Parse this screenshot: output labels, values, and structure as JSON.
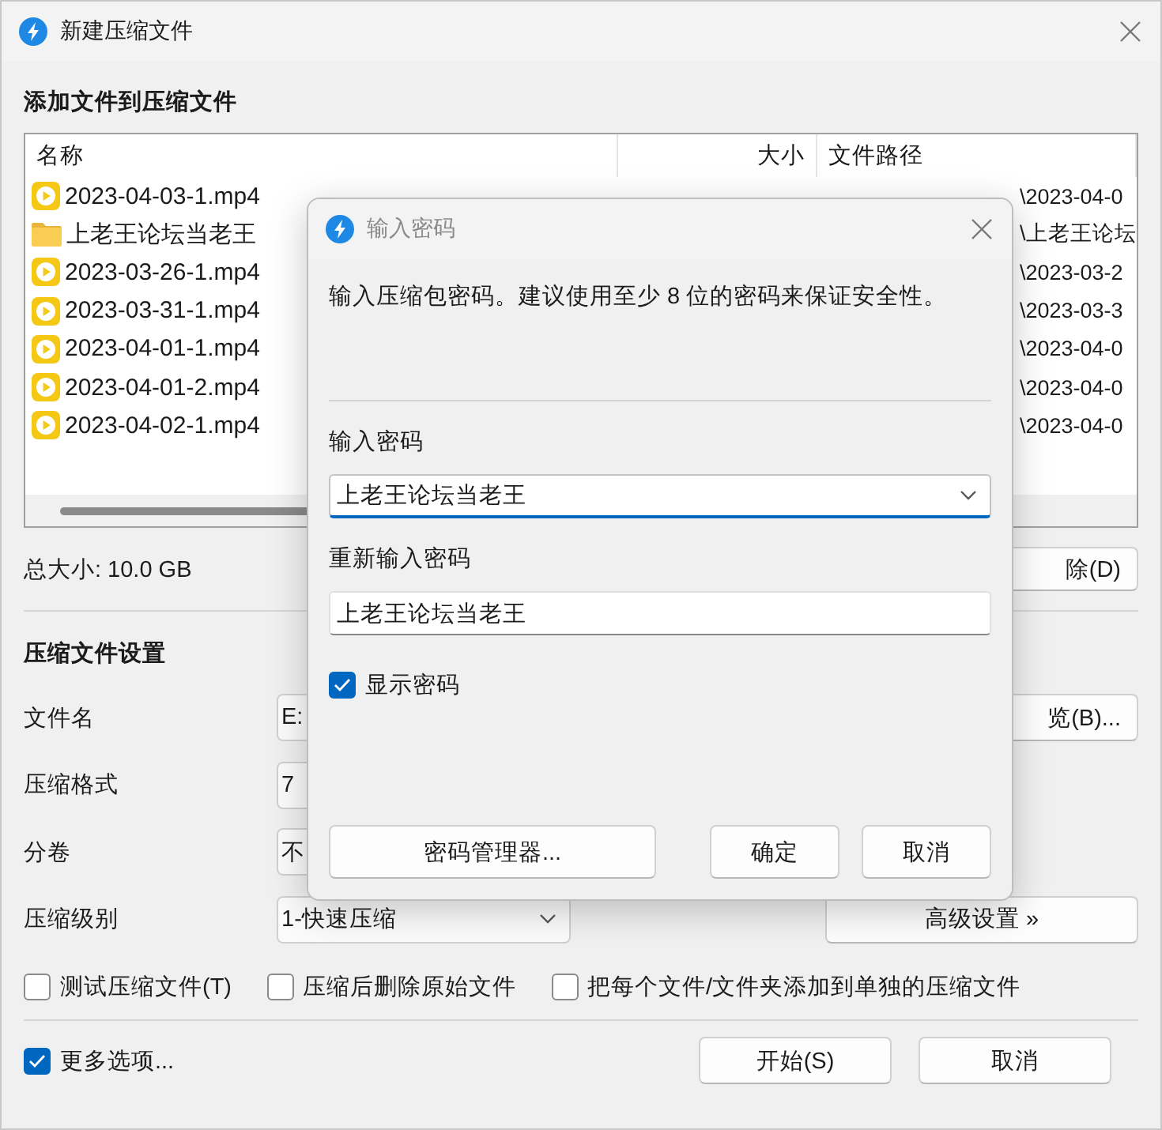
{
  "window": {
    "title": "新建压缩文件"
  },
  "files_section": {
    "heading": "添加文件到压缩文件",
    "columns": [
      "名称",
      "大小",
      "文件路径"
    ],
    "rows": [
      {
        "kind": "video",
        "name": "2023-04-03-1.mp4",
        "path": "\\2023-04-0"
      },
      {
        "kind": "folder",
        "name": "上老王论坛当老王",
        "path": "\\上老王论坛"
      },
      {
        "kind": "video",
        "name": "2023-03-26-1.mp4",
        "path": "\\2023-03-2"
      },
      {
        "kind": "video",
        "name": "2023-03-31-1.mp4",
        "path": "\\2023-03-3"
      },
      {
        "kind": "video",
        "name": "2023-04-01-1.mp4",
        "path": "\\2023-04-0"
      },
      {
        "kind": "video",
        "name": "2023-04-01-2.mp4",
        "path": "\\2023-04-0"
      },
      {
        "kind": "video",
        "name": "2023-04-02-1.mp4",
        "path": "\\2023-04-0"
      }
    ],
    "total_size": "总大小: 10.0 GB",
    "delete_button": "除(D)"
  },
  "settings": {
    "heading": "压缩文件设置",
    "fields": [
      {
        "label": "文件名",
        "kind": "text",
        "value": "E:",
        "button": "览(B)..."
      },
      {
        "label": "压缩格式",
        "kind": "select",
        "value": "7"
      },
      {
        "label": "分卷",
        "kind": "select",
        "value": "不"
      },
      {
        "label": "压缩级别",
        "kind": "dropdown",
        "value": "1-快速压缩",
        "button": "高级设置 »"
      }
    ],
    "options": [
      {
        "label": "测试压缩文件(T)",
        "checked": false
      },
      {
        "label": "压缩后删除原始文件",
        "checked": false
      },
      {
        "label": "把每个文件/文件夹添加到单独的压缩文件",
        "checked": false
      }
    ]
  },
  "footer": {
    "more_options": {
      "label": "更多选项...",
      "checked": true
    },
    "buttons": [
      "开始(S)",
      "取消"
    ]
  },
  "dialog": {
    "title": "输入密码",
    "description": "输入压缩包密码。建议使用至少 8 位的密码来保证安全性。",
    "password_label": "输入密码",
    "password_value": "上老王论坛当老王",
    "confirm_label": "重新输入密码",
    "confirm_value": "上老王论坛当老王",
    "show_password": {
      "label": "显示密码",
      "checked": true
    },
    "buttons": [
      {
        "kind": "wide",
        "label": "密码管理器..."
      },
      {
        "kind": "normal",
        "label": "确定"
      },
      {
        "kind": "normal",
        "label": "取消"
      }
    ]
  }
}
